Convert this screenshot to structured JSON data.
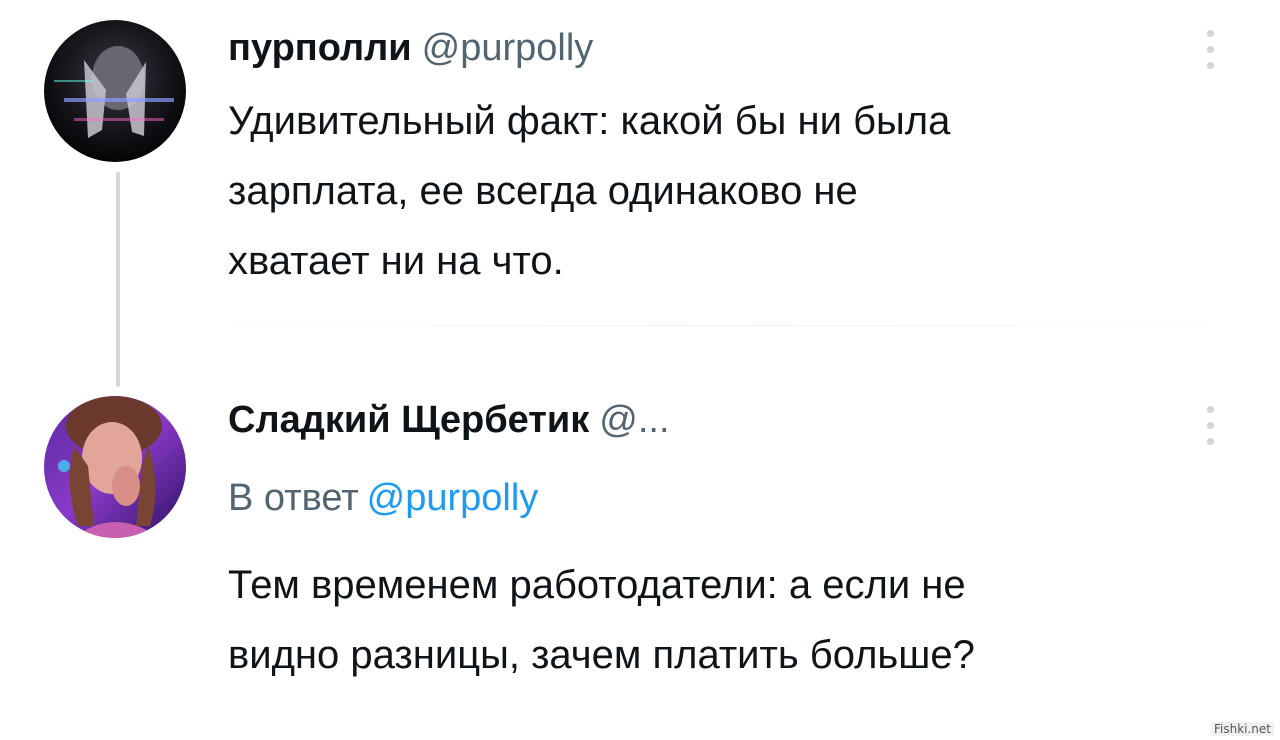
{
  "tweet1": {
    "display_name": "пурполли",
    "handle": "@purpolly",
    "text_lines": [
      "Удивительный факт: какой бы ни была",
      "зарплата, ее всегда одинаково не",
      "хватает ни на что."
    ],
    "avatar_icon": "user-avatar-dark-hands"
  },
  "tweet2": {
    "display_name": "Сладкий Щербетик",
    "handle": "@...",
    "reply_prefix": "В ответ",
    "reply_to": "@purpolly",
    "text_lines": [
      "Тем временем работодатели: а если не",
      "видно разницы, зачем платить больше?"
    ],
    "avatar_icon": "user-avatar-purple-portrait"
  },
  "colors": {
    "text": "#0f1419",
    "muted": "#536471",
    "link": "#1d9bf0",
    "thread_line": "#cfd9de"
  },
  "watermark": "Fishki.net"
}
